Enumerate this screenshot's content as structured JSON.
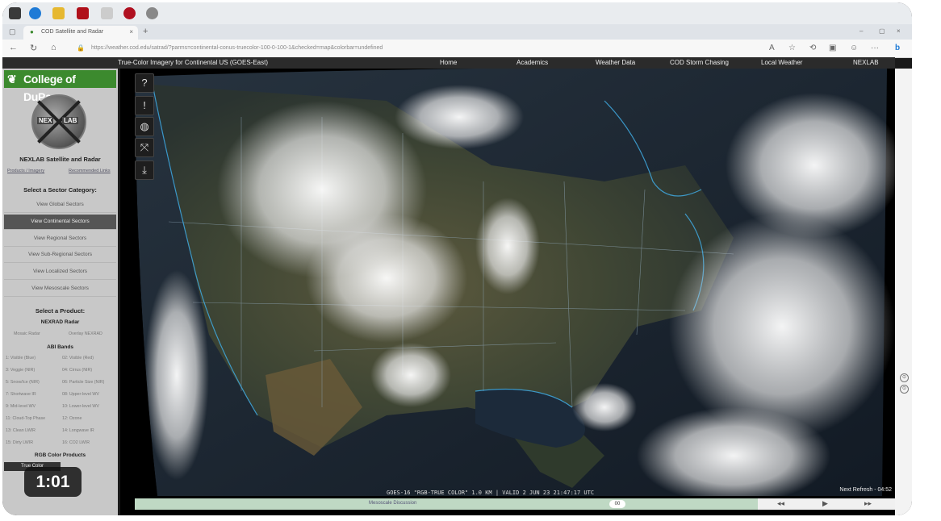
{
  "video": {
    "timestamp": "1:01"
  },
  "browser": {
    "tab_title": "COD Satellite and Radar",
    "url": "https://weather.cod.edu/satrad/?parms=continental-conus-truecolor-100-0-100-1&checked=map&colorbar=undefined",
    "clock_time": "",
    "clock_date": ""
  },
  "site": {
    "page_heading": "True-Color Imagery for Continental US (GOES-East)",
    "nav": [
      "Home",
      "Academics",
      "Weather Data",
      "COD Storm Chasing",
      "Local Weather",
      "NEXLAB"
    ]
  },
  "sidebar": {
    "logo_text": "College of DuPage",
    "badge_left": "NEX",
    "badge_right": "LAB",
    "title": "NEXLAB Satellite and Radar",
    "links": [
      "Products / Imagery",
      "Recommended Links"
    ],
    "sector_heading": "Select a Sector Category:",
    "sectors": [
      {
        "label": "View Global Sectors",
        "active": false
      },
      {
        "label": "View Continental Sectors",
        "active": true
      },
      {
        "label": "View Regional Sectors",
        "active": false
      },
      {
        "label": "View Sub-Regional Sectors",
        "active": false
      },
      {
        "label": "View Localized Sectors",
        "active": false
      },
      {
        "label": "View Mesoscale Sectors",
        "active": false
      }
    ],
    "product_heading": "Select a Product:",
    "nexrad_heading": "NEXRAD Radar",
    "nexrad_items": [
      "Mosaic Radar",
      "Overlay NEXRAD"
    ],
    "abi_heading": "ABI Bands",
    "abi_bands": [
      "1: Visible (Blue)",
      "02: Visible (Red)",
      "3: Veggie (NIR)",
      "04: Cirrus (NIR)",
      "5: Snow/Ice (NIR)",
      "06: Particle Size (NIR)",
      "7: Shortwave IR",
      "08: Upper-level WV",
      "9: Mid-level WV",
      "10: Lower-level WV",
      "11: Cloud-Top Phase",
      "12: Ozone",
      "13: Clean LWIR",
      "14: Longwave IR",
      "15: Dirty LWIR",
      "16: CO2 LWIR"
    ],
    "rgb_heading": "RGB Color Products",
    "rgb_active": "True Color"
  },
  "map": {
    "caption": "GOES-16 \"RGB-TRUE COLOR\" 1.0 KM | VALID 2 JUN 23 21:47:17 UTC",
    "refresh": "Next Refresh - 04:52",
    "timebar_label": "Mesoscale Discussion",
    "knob": "00",
    "tools": [
      "help",
      "info",
      "globe",
      "fullscreen",
      "download"
    ]
  }
}
